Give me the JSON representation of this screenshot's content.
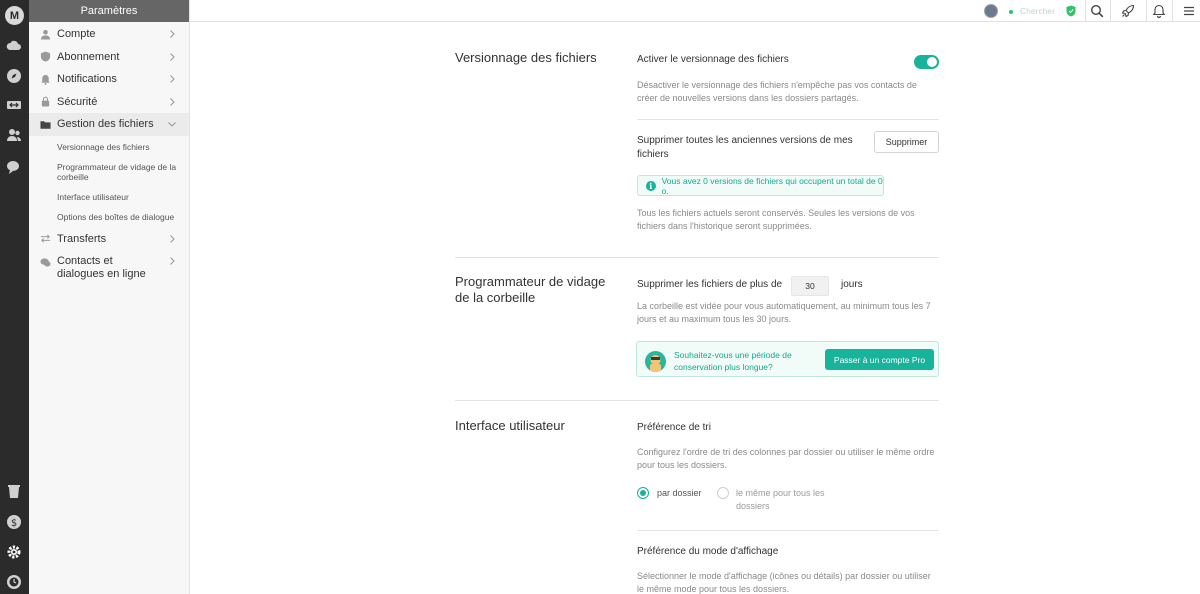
{
  "rail": {
    "logo": "M",
    "icons": [
      "cloud-icon",
      "compass-icon",
      "transfer-icon",
      "contacts-icon",
      "chat-icon",
      "trash-icon",
      "dollar-icon",
      "settings-icon",
      "clock-icon"
    ]
  },
  "sidebar": {
    "title": "Paramètres",
    "items": [
      {
        "label": "Compte",
        "icon": "user-icon"
      },
      {
        "label": "Abonnement",
        "icon": "shield-icon"
      },
      {
        "label": "Notifications",
        "icon": "bell-icon"
      },
      {
        "label": "Sécurité",
        "icon": "lock-icon"
      },
      {
        "label": "Gestion des fichiers",
        "icon": "folder-icon"
      },
      {
        "label": "Transferts",
        "icon": "transfer-icon"
      },
      {
        "label": "Contacts et dialogues en ligne",
        "icon": "chat-icon"
      }
    ],
    "subitems": [
      {
        "label": "Versionnage des fichiers"
      },
      {
        "label": "Programmateur de vidage de la corbeille"
      },
      {
        "label": "Interface utilisateur"
      },
      {
        "label": "Options des boîtes de dialogue"
      }
    ]
  },
  "topbar": {
    "user_name": "Chercher",
    "status_color": "#2fc26b",
    "icons": [
      "search-icon",
      "rocket-icon",
      "bell-icon",
      "menu-icon"
    ]
  },
  "versioning": {
    "title": "Versionnage des fichiers",
    "toggle_label": "Activer le versionnage des fichiers",
    "toggle_on": true,
    "toggle_desc": "Désactiver le versionnage des fichiers n'empêche pas vos contacts de créer de nouvelles versions dans les dossiers partagés.",
    "delete_label": "Supprimer toutes les anciennes versions de mes fichiers",
    "delete_button": "Supprimer",
    "info_text": "Vous avez 0 versions de fichiers qui occupent un total de 0 o.",
    "delete_desc": "Tous les fichiers actuels seront conservés. Seules les versions de vos fichiers dans l'historique seront supprimées."
  },
  "scheduler": {
    "title": "Programmateur de vidage de la corbeille",
    "delete_prefix": "Supprimer les fichiers de plus de",
    "days_value": "30",
    "days_suffix": "jours",
    "desc": "La corbeille est vidée pour vous automatiquement, au minimum tous les 7 jours et au maximum tous les 30 jours.",
    "pro_text": "Souhaitez-vous une période de conservation plus longue?",
    "pro_button": "Passer à un compte Pro"
  },
  "ui": {
    "title": "Interface utilisateur",
    "sort_title": "Préférence de tri",
    "sort_desc": "Configurez l'ordre de tri des colonnes par dossier ou utiliser le même ordre pour tous les dossiers.",
    "radio_per_folder": "par dossier",
    "radio_same": "le même pour tous les dossiers",
    "selected": "par dossier",
    "view_title": "Préférence du mode d'affichage",
    "view_desc": "Sélectionner le mode d'affichage (icônes ou détails) par dossier ou utiliser le même mode pour tous les dossiers."
  },
  "colors": {
    "accent": "#17b39b",
    "rail": "#2b2b2b",
    "sidebar_header": "#666666"
  }
}
